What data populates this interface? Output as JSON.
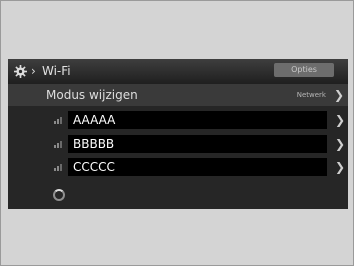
{
  "header": {
    "title": "Wi-Fi",
    "options_label": "Opties",
    "gear_icon": "gear-icon"
  },
  "modus": {
    "label": "Modus wijzigen",
    "value": "Netwerk"
  },
  "networks": [
    {
      "name": "AAAAA",
      "icon": "wifi-signal-icon"
    },
    {
      "name": "BBBBB",
      "icon": "wifi-signal-icon"
    },
    {
      "name": "CCCCC",
      "icon": "wifi-signal-icon"
    }
  ],
  "colors": {
    "screen_bg": "#262626",
    "row_highlight": "#000000",
    "text": "#ffffff"
  }
}
